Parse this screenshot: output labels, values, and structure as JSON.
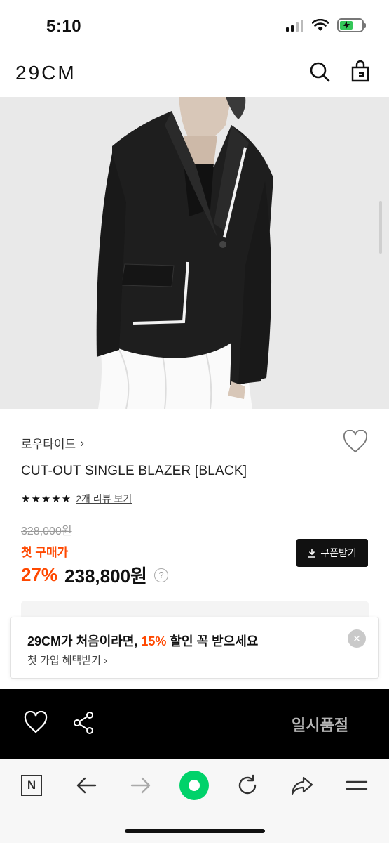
{
  "status": {
    "time": "5:10"
  },
  "header": {
    "logo": "29CM"
  },
  "product": {
    "brand": "로우타이드",
    "brand_chevron": "›",
    "name": "CUT-OUT SINGLE BLAZER [BLACK]",
    "rating_stars": "★★★★★",
    "rating_value": 5,
    "review_link": "2개 리뷰 보기",
    "original_price": "328,000원",
    "first_purchase_label": "첫 구매가",
    "discount": "27%",
    "price": "238,800원",
    "help_glyph": "?",
    "coupon_button": "쿠폰받기"
  },
  "promo": {
    "main_prefix": "29CM가 처음이라면, ",
    "main_highlight": "15%",
    "main_suffix": " 할인 꼭 받으세요",
    "sub": "첫 가입 혜택받기 ›",
    "close_glyph": "✕"
  },
  "buy_bar": {
    "soldout_label": "일시품절"
  },
  "browser": {
    "n_button": "N"
  },
  "colors": {
    "accent": "#ff4800",
    "buy_bar": "#000000",
    "browser_green": "#00d26a"
  }
}
